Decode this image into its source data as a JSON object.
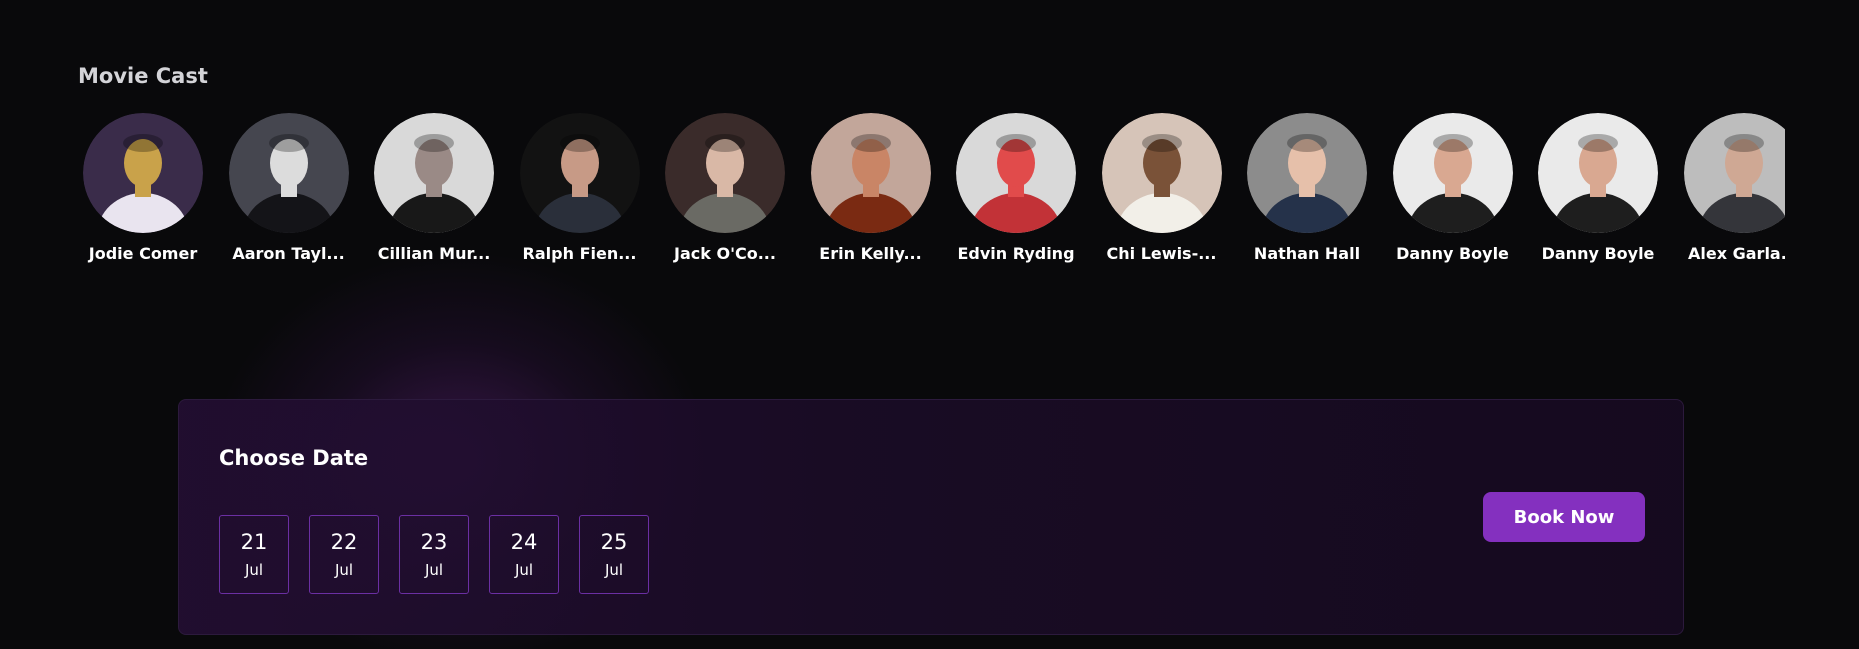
{
  "cast_section": {
    "title": "Movie Cast",
    "members": [
      {
        "name": "Jodie Comer",
        "avatar_colors": [
          "#3a2c4a",
          "#e9e4ef",
          "#c9a24a"
        ]
      },
      {
        "name": "Aaron Tayl...",
        "avatar_colors": [
          "#45464f",
          "#141418",
          "#dcdcdc"
        ]
      },
      {
        "name": "Cillian Mur...",
        "avatar_colors": [
          "#d9d9d9",
          "#181818",
          "#9a8a86"
        ]
      },
      {
        "name": "Ralph Fien...",
        "avatar_colors": [
          "#121212",
          "#2a2f3a",
          "#c79a86"
        ]
      },
      {
        "name": "Jack O'Co...",
        "avatar_colors": [
          "#3a2b2a",
          "#6a6a64",
          "#d9b8a6"
        ]
      },
      {
        "name": "Erin Kelly...",
        "avatar_colors": [
          "#c2a69a",
          "#7a2a12",
          "#c98566"
        ]
      },
      {
        "name": "Edvin Ryding",
        "avatar_colors": [
          "#d9d9d9",
          "#c23237",
          "#e14b4b"
        ]
      },
      {
        "name": "Chi Lewis-...",
        "avatar_colors": [
          "#d6c4b8",
          "#f2efe8",
          "#7a5238"
        ]
      },
      {
        "name": "Nathan Hall",
        "avatar_colors": [
          "#8c8c8c",
          "#25324a",
          "#e6c0aa"
        ]
      },
      {
        "name": "Danny Boyle",
        "avatar_colors": [
          "#eaeaea",
          "#1e1e1e",
          "#d9a891"
        ]
      },
      {
        "name": "Danny Boyle",
        "avatar_colors": [
          "#eaeaea",
          "#1e1e1e",
          "#d9a891"
        ]
      },
      {
        "name": "Alex Garla...",
        "avatar_colors": [
          "#bdbdbd",
          "#34353a",
          "#cfa894"
        ]
      }
    ]
  },
  "booking": {
    "title": "Choose Date",
    "dates": [
      {
        "day": "21",
        "month": "Jul"
      },
      {
        "day": "22",
        "month": "Jul"
      },
      {
        "day": "23",
        "month": "Jul"
      },
      {
        "day": "24",
        "month": "Jul"
      },
      {
        "day": "25",
        "month": "Jul"
      }
    ],
    "book_button_label": "Book Now",
    "accent_color": "#8430bf",
    "date_border_color": "#6b2fa3"
  }
}
